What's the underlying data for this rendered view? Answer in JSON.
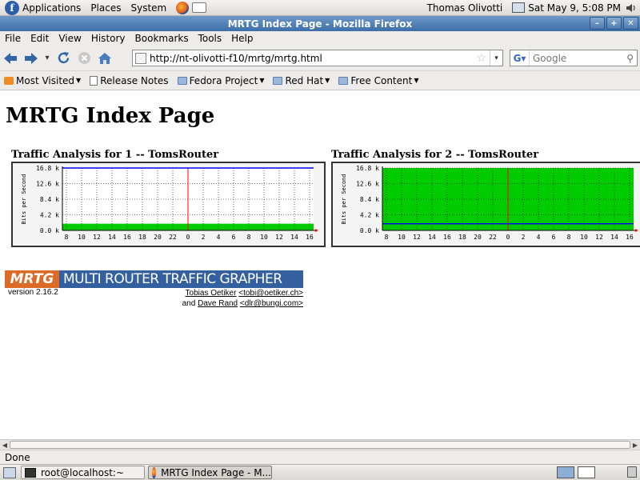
{
  "panel": {
    "menus": [
      "Applications",
      "Places",
      "System"
    ],
    "user": "Thomas Olivotti",
    "clock": "Sat May  9,  5:08 PM"
  },
  "window": {
    "title": "MRTG Index Page - Mozilla Firefox"
  },
  "menubar": [
    "File",
    "Edit",
    "View",
    "History",
    "Bookmarks",
    "Tools",
    "Help"
  ],
  "navbar": {
    "url": "http://nt-olivotti-f10/mrtg/mrtg.html",
    "search_placeholder": "Google"
  },
  "bookmarks": [
    "Most Visited",
    "Release Notes",
    "Fedora Project",
    "Red Hat",
    "Free Content"
  ],
  "page": {
    "title": "MRTG Index Page",
    "graph1_title": "Traffic Analysis for 1 -- TomsRouter",
    "graph2_title": "Traffic Analysis for 2 -- TomsRouter",
    "logo_left": "MRTG",
    "logo_right": "MULTI ROUTER TRAFFIC GRAPHER",
    "version": "version 2.16.2",
    "author1": "Tobias Oetiker",
    "author1_email": "<tobi@oetiker.ch>",
    "and": "and",
    "author2": "Dave Rand",
    "author2_email": "<dlr@bungi.com>"
  },
  "chart_data": [
    {
      "type": "area",
      "title": "Traffic Analysis for 1 -- TomsRouter",
      "ylabel": "Bits per Second",
      "ytick_labels": [
        "0.0 k",
        "4.2 k",
        "8.4 k",
        "12.6 k",
        "16.8 k"
      ],
      "yticks": [
        0,
        4.2,
        8.4,
        12.6,
        16.8
      ],
      "ylim": [
        0,
        16.8
      ],
      "x_labels": [
        "8",
        "10",
        "12",
        "14",
        "16",
        "18",
        "20",
        "22",
        "0",
        "2",
        "4",
        "6",
        "8",
        "10",
        "12",
        "14",
        "16"
      ],
      "series": [
        {
          "values": [
            1.8,
            1.8,
            1.8,
            1.8,
            1.8,
            1.8,
            1.8,
            1.8,
            1.8,
            1.8,
            1.8,
            1.8,
            1.8,
            1.8,
            1.8,
            1.8,
            1.8
          ],
          "color": "#00cc00",
          "style": "area"
        },
        {
          "values": [
            16.8,
            16.8,
            16.8,
            16.8,
            16.8,
            16.8,
            16.8,
            16.8,
            16.8,
            16.8,
            16.8,
            16.8,
            16.8,
            16.8,
            16.8,
            16.8,
            16.8
          ],
          "color": "#0000ff",
          "style": "line"
        }
      ],
      "grid": true,
      "colors": {
        "area": "#00cc00",
        "line": "#0000ff",
        "midnight": "#ff0000"
      }
    },
    {
      "type": "area",
      "title": "Traffic Analysis for 2 -- TomsRouter",
      "ylabel": "Bits per Second",
      "ytick_labels": [
        "0.0 k",
        "4.2 k",
        "8.4 k",
        "12.6 k",
        "16.8 k"
      ],
      "yticks": [
        0,
        4.2,
        8.4,
        12.6,
        16.8
      ],
      "ylim": [
        0,
        16.8
      ],
      "x_labels": [
        "8",
        "10",
        "12",
        "14",
        "16",
        "18",
        "20",
        "22",
        "0",
        "2",
        "4",
        "6",
        "8",
        "10",
        "12",
        "14",
        "16"
      ],
      "series": [
        {
          "values": [
            16.8,
            16.8,
            16.8,
            16.8,
            16.8,
            16.8,
            16.8,
            16.8,
            16.8,
            16.8,
            16.8,
            16.8,
            16.8,
            16.8,
            16.8,
            16.8,
            16.8
          ],
          "color": "#00cc00",
          "style": "area"
        },
        {
          "values": [
            1.8,
            1.8,
            1.8,
            1.8,
            1.8,
            1.8,
            1.8,
            1.8,
            1.8,
            1.8,
            1.8,
            1.8,
            1.8,
            1.8,
            1.8,
            1.8,
            1.8
          ],
          "color": "#0000ff",
          "style": "line"
        }
      ],
      "grid": true,
      "colors": {
        "area": "#00cc00",
        "line": "#0000ff",
        "midnight": "#ff0000"
      }
    }
  ],
  "statusbar": {
    "text": "Done"
  },
  "taskbar": {
    "tasks": [
      "root@localhost:~",
      "MRTG Index Page - M..."
    ]
  }
}
